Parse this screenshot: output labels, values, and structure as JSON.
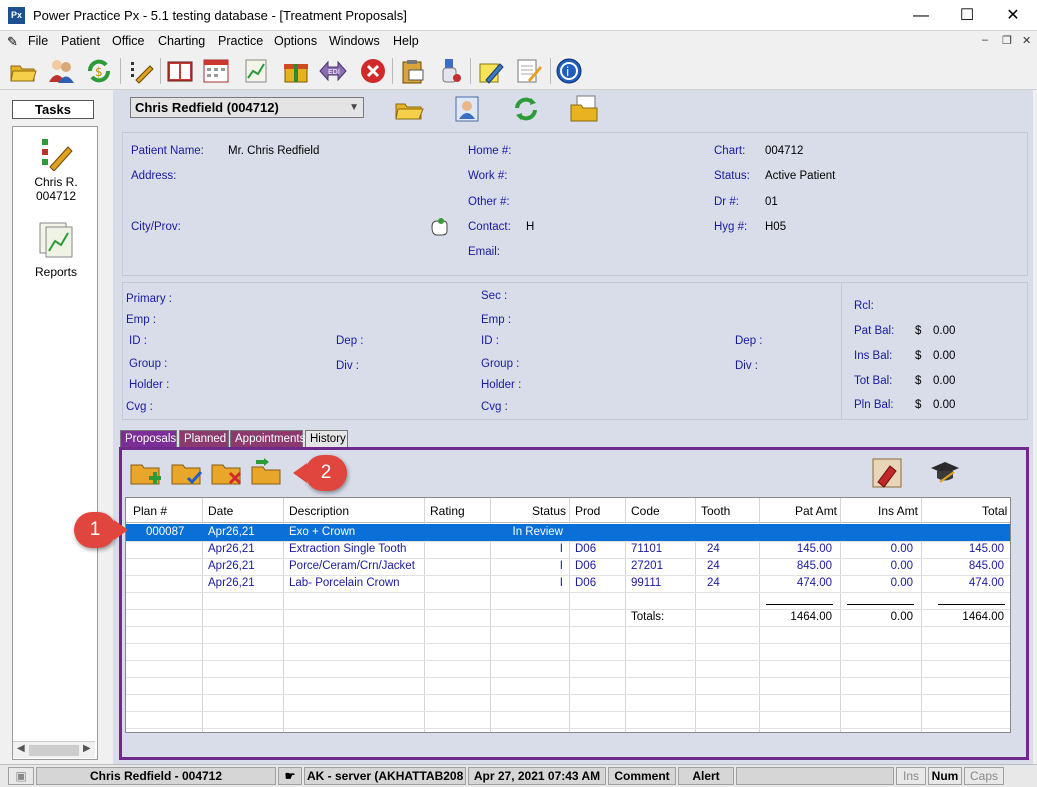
{
  "window": {
    "app_logo": "Px",
    "title": "Power Practice Px - 5.1 testing database - [Treatment Proposals]",
    "minimize": "—",
    "maximize": "☐",
    "close": "✕"
  },
  "menu": {
    "items": [
      "File",
      "Patient",
      "Office",
      "Charting",
      "Practice",
      "Options",
      "Windows",
      "Help"
    ],
    "mdi_minimize": "–",
    "mdi_restore": "❐",
    "mdi_close": "✕"
  },
  "toolbar": {
    "icons": [
      "open-folder-icon",
      "patients-icon",
      "money-refresh-icon",
      "edit-icon",
      "book-icon",
      "calendar-icon",
      "chart-icon",
      "gift-box-icon",
      "edi-icon",
      "stop-icon",
      "clipboard-icon",
      "inhaler-icon",
      "notes-pen-icon",
      "notepad-icon",
      "help-icon"
    ]
  },
  "tasks": {
    "title": "Tasks",
    "patient_line1": "Chris R.",
    "patient_line2": "004712",
    "reports_label": "Reports"
  },
  "patient": {
    "selector": "Chris Redfield (004712)",
    "labels": {
      "name": "Patient Name:",
      "address": "Address:",
      "city": "City/Prov:",
      "home": "Home #:",
      "work": "Work #:",
      "other": "Other #:",
      "contact": "Contact:",
      "email": "Email:",
      "chart": "Chart:",
      "status": "Status:",
      "dr": "Dr #:",
      "hyg": "Hyg #:"
    },
    "name": "Mr. Chris Redfield",
    "contact": "H",
    "chart": "004712",
    "status": "Active Patient",
    "dr": "01",
    "hyg": "H05"
  },
  "insurance": {
    "primary_labels": {
      "primary": "Primary :",
      "emp": "Emp :",
      "id": "ID :",
      "group": "Group :",
      "holder": "Holder :",
      "cvg": "Cvg :",
      "dep": "Dep :",
      "div": "Div :"
    },
    "sec_labels": {
      "sec": "Sec :",
      "emp": "Emp :",
      "id": "ID :",
      "group": "Group :",
      "holder": "Holder :",
      "cvg": "Cvg :",
      "dep": "Dep :",
      "div": "Div :"
    },
    "balances": {
      "rcl": "Rcl:",
      "pat_bal_label": "Pat Bal:",
      "ins_bal_label": "Ins Bal:",
      "tot_bal_label": "Tot Bal:",
      "pln_bal_label": "Pln Bal:",
      "currency": "$",
      "pat_bal": "0.00",
      "ins_bal": "0.00",
      "tot_bal": "0.00",
      "pln_bal": "0.00"
    }
  },
  "tabs": [
    "Proposals",
    "Planned",
    "Appointments",
    "History"
  ],
  "proposals": {
    "columns": [
      "Plan #",
      "Date",
      "Description",
      "Rating",
      "Status",
      "Prod",
      "Code",
      "Tooth",
      "Pat Amt",
      "Ins Amt",
      "Total"
    ],
    "rows": [
      {
        "plan": "000087",
        "date": "Apr26,21",
        "desc": "Exo + Crown",
        "rating": "",
        "status": "In Review",
        "prod": "",
        "code": "",
        "tooth": "",
        "pat": "",
        "ins": "",
        "total": ""
      },
      {
        "plan": "",
        "date": "Apr26,21",
        "desc": "Extraction Single Tooth",
        "rating": "",
        "status": "I",
        "prod": "D06",
        "code": "71101",
        "tooth": "24",
        "pat": "145.00",
        "ins": "0.00",
        "total": "145.00"
      },
      {
        "plan": "",
        "date": "Apr26,21",
        "desc": "Porce/Ceram/Crn/Jacket",
        "rating": "",
        "status": "I",
        "prod": "D06",
        "code": "27201",
        "tooth": "24",
        "pat": "845.00",
        "ins": "0.00",
        "total": "845.00"
      },
      {
        "plan": "",
        "date": "Apr26,21",
        "desc": "Lab- Porcelain Crown",
        "rating": "",
        "status": "I",
        "prod": "D06",
        "code": "99111",
        "tooth": "24",
        "pat": "474.00",
        "ins": "0.00",
        "total": "474.00"
      }
    ],
    "totals_label": "Totals:",
    "totals": {
      "pat": "1464.00",
      "ins": "0.00",
      "total": "1464.00"
    }
  },
  "markers": {
    "one": "1",
    "two": "2"
  },
  "statusbar": {
    "patient": "Chris Redfield - 004712",
    "server": "AK - server (AKHATTAB208",
    "datetime": "Apr 27, 2021 07:43 AM",
    "comment": "Comment",
    "alert": "Alert",
    "ins": "Ins",
    "num": "Num",
    "caps": "Caps"
  }
}
